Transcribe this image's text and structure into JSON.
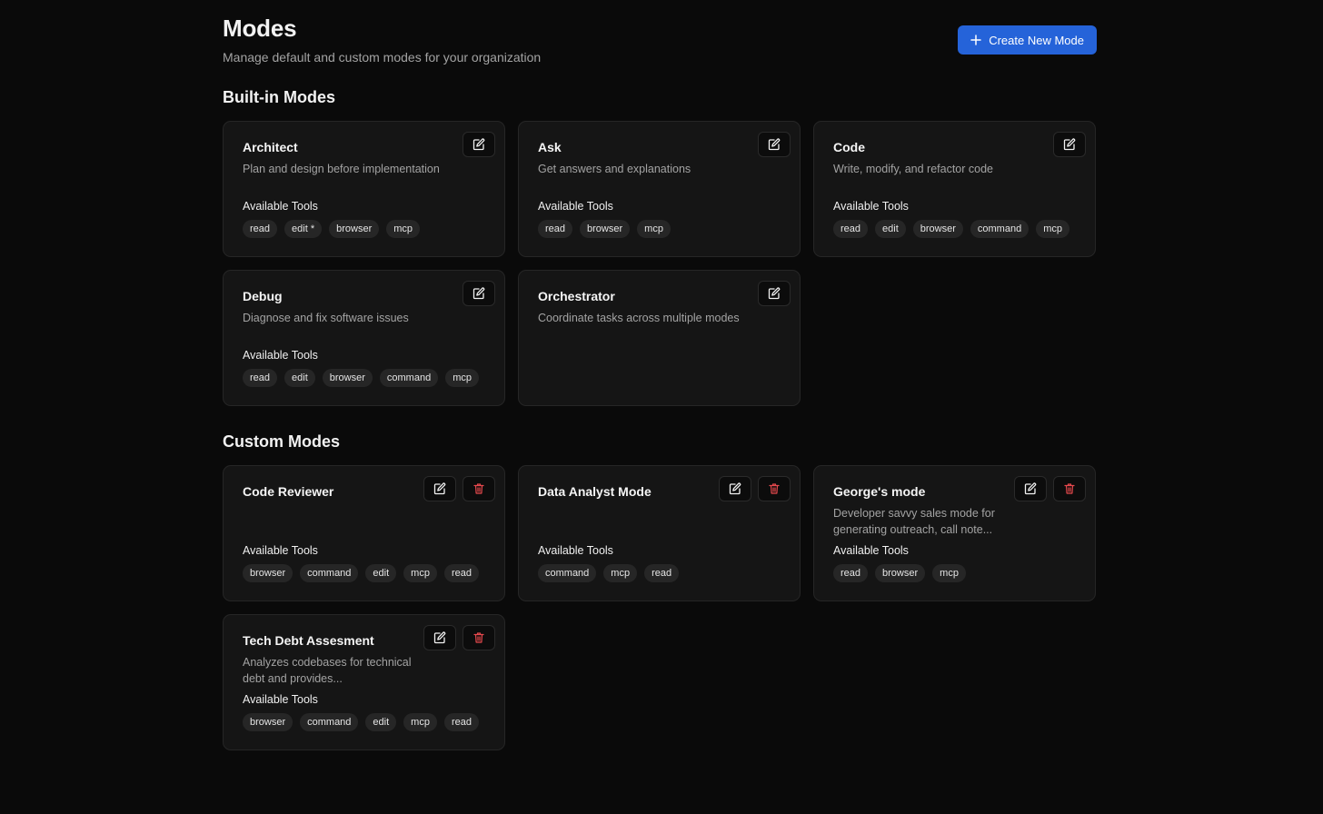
{
  "header": {
    "title": "Modes",
    "subtitle": "Manage default and custom modes for your organization",
    "create_button_label": "Create New Mode"
  },
  "sections": {
    "builtin_title": "Built-in Modes",
    "custom_title": "Custom Modes"
  },
  "tools_label": "Available Tools",
  "builtin_modes": [
    {
      "name": "Architect",
      "description": "Plan and design before implementation",
      "tools": [
        "read",
        "edit *",
        "browser",
        "mcp"
      ]
    },
    {
      "name": "Ask",
      "description": "Get answers and explanations",
      "tools": [
        "read",
        "browser",
        "mcp"
      ]
    },
    {
      "name": "Code",
      "description": "Write, modify, and refactor code",
      "tools": [
        "read",
        "edit",
        "browser",
        "command",
        "mcp"
      ]
    },
    {
      "name": "Debug",
      "description": "Diagnose and fix software issues",
      "tools": [
        "read",
        "edit",
        "browser",
        "command",
        "mcp"
      ]
    },
    {
      "name": "Orchestrator",
      "description": "Coordinate tasks across multiple modes",
      "tools": []
    }
  ],
  "custom_modes": [
    {
      "name": "Code Reviewer",
      "description": "",
      "tools": [
        "browser",
        "command",
        "edit",
        "mcp",
        "read"
      ]
    },
    {
      "name": "Data Analyst Mode",
      "description": "",
      "tools": [
        "command",
        "mcp",
        "read"
      ]
    },
    {
      "name": "George's mode",
      "description": "Developer savvy sales mode for generating outreach, call note...",
      "tools": [
        "read",
        "browser",
        "mcp"
      ]
    },
    {
      "name": "Tech Debt Assesment",
      "description": "Analyzes codebases for technical debt and provides...",
      "tools": [
        "browser",
        "command",
        "edit",
        "mcp",
        "read"
      ]
    }
  ],
  "icons": {
    "create": "plus-icon",
    "edit": "edit-icon",
    "delete": "trash-icon"
  },
  "colors": {
    "accent": "#2563d9",
    "delete": "#e5484d",
    "background": "#0a0a0a",
    "card": "#151515"
  }
}
